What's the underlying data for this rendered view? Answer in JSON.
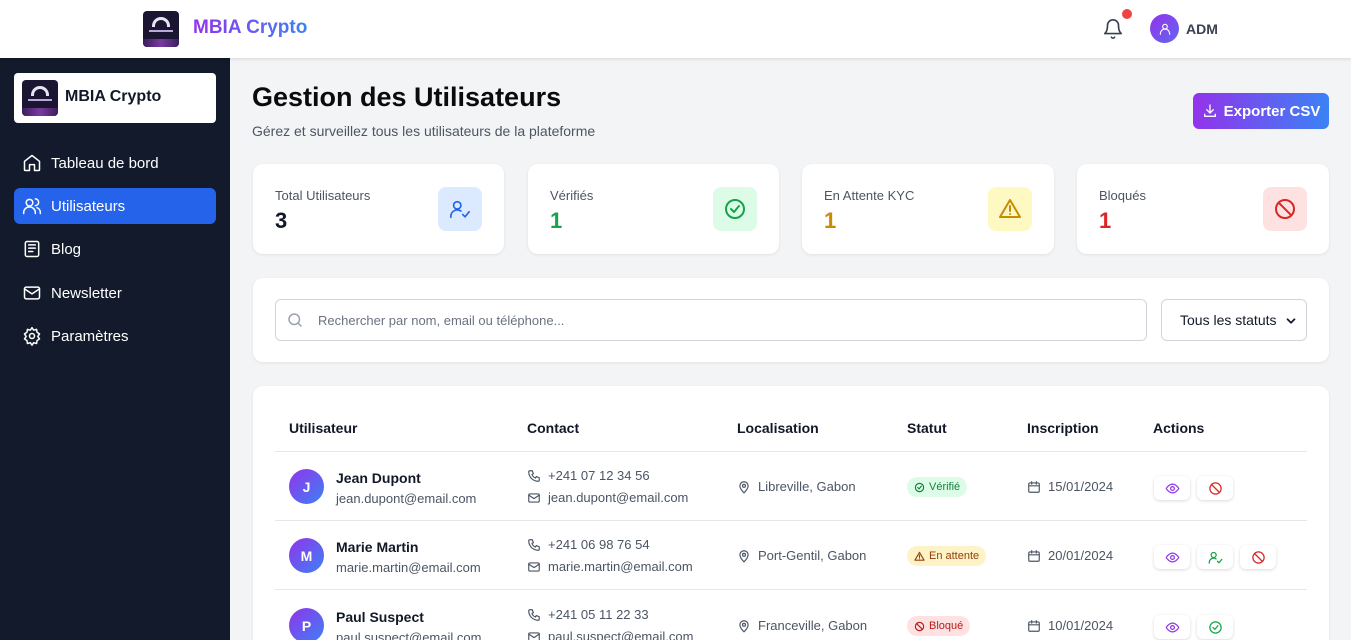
{
  "brand": {
    "name": "MBIA Crypto"
  },
  "topbar": {
    "user_label": "ADM",
    "notifications_icon": "bell-icon",
    "avatar_icon": "user-icon"
  },
  "sidebar": {
    "brand_name": "MBIA Crypto",
    "items": [
      {
        "label": "Tableau de bord",
        "icon": "home-icon",
        "active": false
      },
      {
        "label": "Utilisateurs",
        "icon": "users-icon",
        "active": true
      },
      {
        "label": "Blog",
        "icon": "newspaper-icon",
        "active": false
      },
      {
        "label": "Newsletter",
        "icon": "mail-icon",
        "active": false
      },
      {
        "label": "Paramètres",
        "icon": "gear-icon",
        "active": false
      }
    ]
  },
  "header": {
    "title": "Gestion des Utilisateurs",
    "subtitle": "Gérez et surveillez tous les utilisateurs de la plateforme",
    "export_label": "Exporter CSV"
  },
  "stats": [
    {
      "label": "Total Utilisateurs",
      "value": "3",
      "value_color": "#111827",
      "icon": "user-check-icon",
      "icon_bg": "#dbeafe"
    },
    {
      "label": "Vérifiés",
      "value": "1",
      "value_color": "#16a34a",
      "icon": "check-circle-icon",
      "icon_bg": "#dcfce7"
    },
    {
      "label": "En Attente KYC",
      "value": "1",
      "value_color": "#ca8a04",
      "icon": "warning-icon",
      "icon_bg": "#fef9c3"
    },
    {
      "label": "Bloqués",
      "value": "1",
      "value_color": "#dc2626",
      "icon": "ban-icon",
      "icon_bg": "#fee2e2"
    }
  ],
  "filters": {
    "search_placeholder": "Rechercher par nom, email ou téléphone...",
    "search_value": "",
    "status_selected": "Tous les statuts"
  },
  "table": {
    "headers": [
      "Utilisateur",
      "Contact",
      "Localisation",
      "Statut",
      "Inscription",
      "Actions"
    ],
    "rows": [
      {
        "initial": "J",
        "name": "Jean Dupont",
        "email": "jean.dupont@email.com",
        "phone": "+241 07 12 34 56",
        "location": "Libreville, Gabon",
        "status": "Vérifié",
        "status_type": "verified",
        "date": "15/01/2024",
        "actions": [
          "view",
          "block"
        ]
      },
      {
        "initial": "M",
        "name": "Marie Martin",
        "email": "marie.martin@email.com",
        "phone": "+241 06 98 76 54",
        "location": "Port-Gentil, Gabon",
        "status": "En attente",
        "status_type": "pending",
        "date": "20/01/2024",
        "actions": [
          "view",
          "verify",
          "block"
        ]
      },
      {
        "initial": "P",
        "name": "Paul Suspect",
        "email": "paul.suspect@email.com",
        "phone": "+241 05 11 22 33",
        "location": "Franceville, Gabon",
        "status": "Bloqué",
        "status_type": "blocked",
        "date": "10/01/2024",
        "actions": [
          "view",
          "unblock"
        ]
      }
    ]
  },
  "colors": {
    "accent_purple": "#9333ea",
    "accent_blue": "#3b82f6",
    "sidebar_bg": "#121a2b",
    "active_nav": "#2563eb"
  }
}
